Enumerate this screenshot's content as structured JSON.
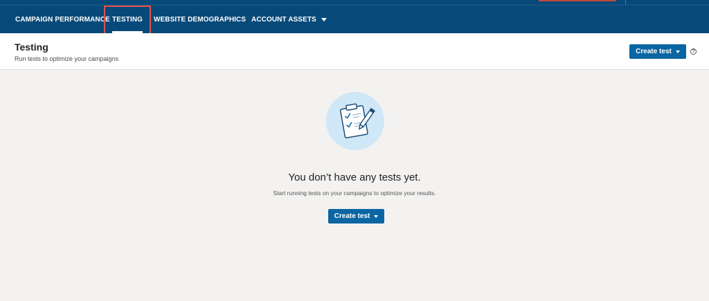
{
  "nav": {
    "items": [
      {
        "label": "CAMPAIGN PERFORMANCE"
      },
      {
        "label": "TESTING"
      },
      {
        "label": "WEBSITE DEMOGRAPHICS"
      },
      {
        "label": "ACCOUNT ASSETS"
      }
    ],
    "active": "TESTING"
  },
  "header": {
    "title": "Testing",
    "subtitle": "Run tests to optimize your campaigns",
    "create_button_label": "Create test",
    "help_icon": "question-circle-icon"
  },
  "empty_state": {
    "illustration_icon": "clipboard-checklist-pencil-icon",
    "title": "You don’t have any tests yet.",
    "subtitle": "Start running tests on your campaigns to optimize your results.",
    "create_button_label": "Create test"
  },
  "colors": {
    "nav_background": "#074a7a",
    "primary_button": "#0a66a3",
    "highlight_outline": "#e0524a",
    "main_background": "#f3f2f1",
    "illustration_circle": "#cfe7f6"
  }
}
